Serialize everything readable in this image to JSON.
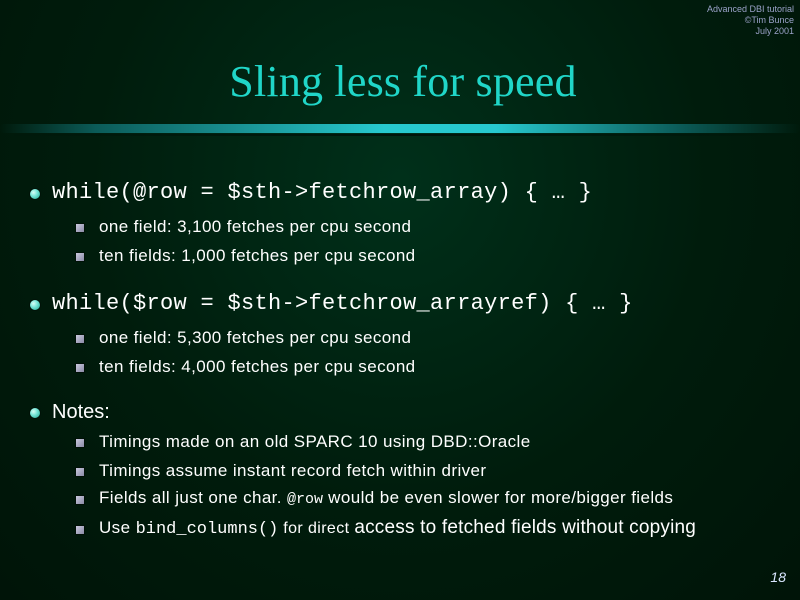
{
  "header": {
    "course": "Advanced DBI tutorial",
    "author": "©Tim Bunce",
    "date": "July 2001"
  },
  "title": "Sling less for speed",
  "bullets": [
    {
      "code": "while(@row = $sth->fetchrow_array) { … }",
      "subitems": [
        "one field:  3,100 fetches per cpu second",
        "ten fields: 1,000 fetches per cpu second"
      ]
    },
    {
      "code": "while($row = $sth->fetchrow_arrayref) { … }",
      "subitems": [
        "one field:  5,300 fetches per cpu second",
        "ten fields: 4,000 fetches per cpu second"
      ]
    },
    {
      "text": "Notes:",
      "subitems": [
        "Timings made on an old SPARC 10 using DBD::Oracle",
        "Timings assume instant record fetch within driver",
        {
          "prefix": "Fields all just one char. ",
          "code": "@row",
          "suffix": " would be even slower for more/bigger fields"
        },
        {
          "prefix": "Use ",
          "code": "bind_columns()",
          "suffix_small": " for direct ",
          "suffix_large": "access to fetched fields without copying"
        }
      ]
    }
  ],
  "page_number": "18",
  "colors": {
    "background": "#001c0c",
    "title": "#20d6c8",
    "bullet_dot": "#78e6d8",
    "rule": "#27c9cf",
    "text": "#ffffff",
    "meta": "#9aa2c8"
  },
  "icons": {
    "level1_bullet": "round-dot-icon",
    "level2_bullet": "square-bullet-icon"
  }
}
